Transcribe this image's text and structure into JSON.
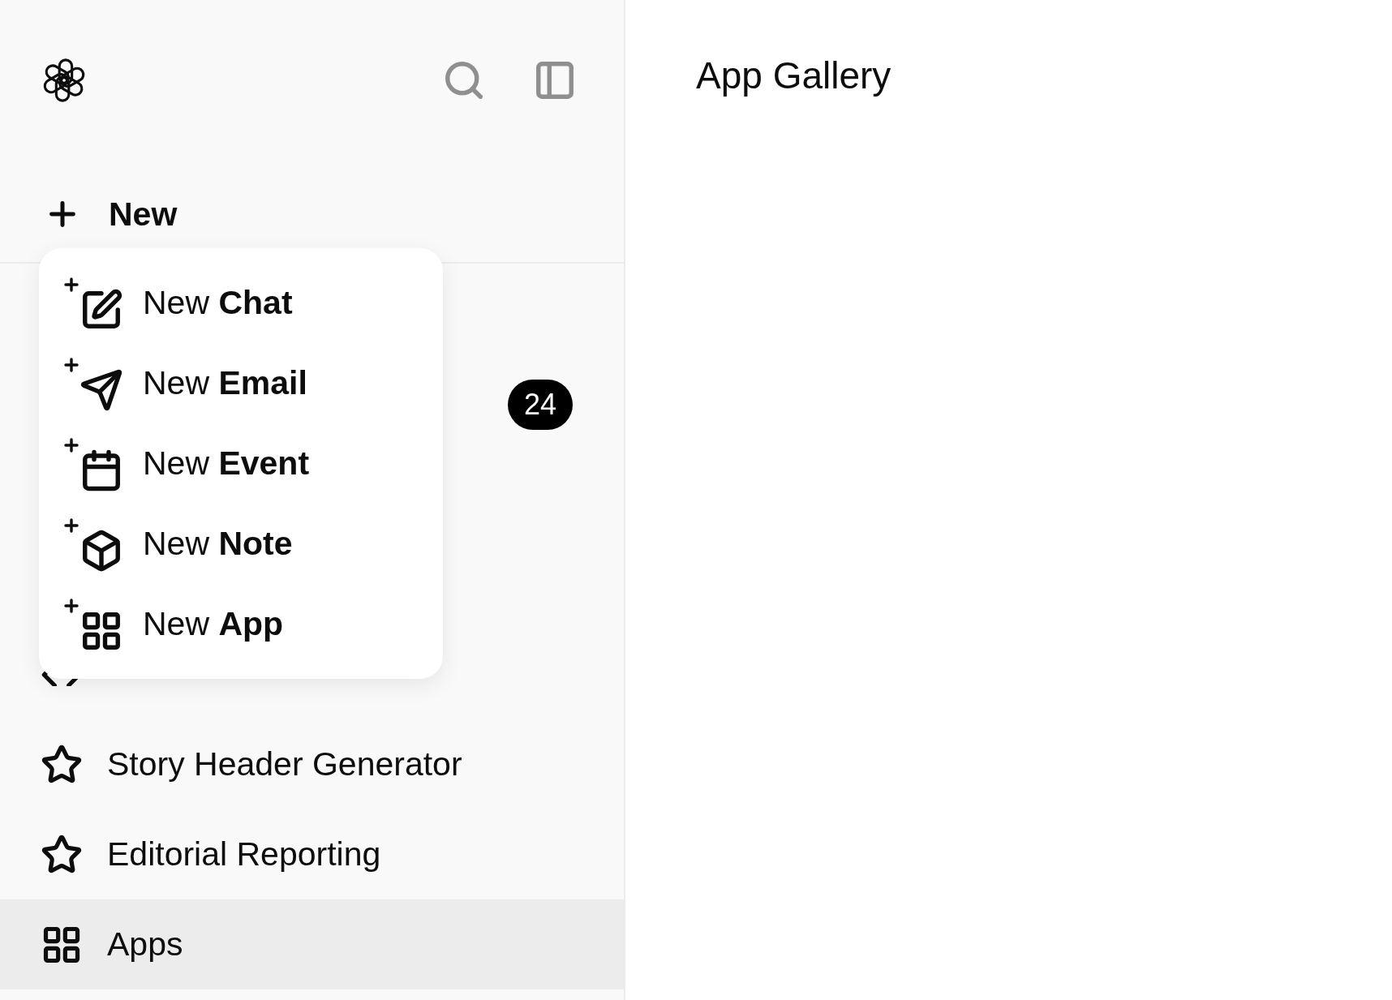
{
  "sidebar": {
    "new_button": "New",
    "badge_row": {
      "badge": "24"
    },
    "items": [
      {
        "kind": "code",
        "selected": false
      },
      {
        "kind": "star",
        "label": "Story Header Generator",
        "selected": false
      },
      {
        "kind": "star",
        "label": "Editorial Reporting",
        "selected": false
      },
      {
        "kind": "apps",
        "label": "Apps",
        "selected": true
      }
    ]
  },
  "new_menu": [
    {
      "kind": "chat",
      "label": "New **Chat**"
    },
    {
      "kind": "email",
      "label": "New **Email**"
    },
    {
      "kind": "event",
      "label": "New **Event**"
    },
    {
      "kind": "note",
      "label": "New **Note**"
    },
    {
      "kind": "app",
      "label": "New **App**"
    }
  ],
  "main": {
    "title": "App Gallery"
  }
}
